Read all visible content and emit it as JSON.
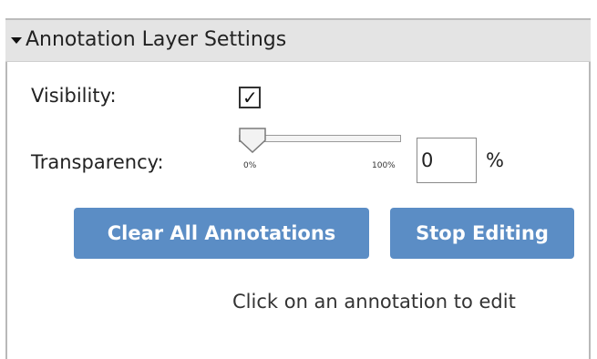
{
  "panel": {
    "title": "Annotation Layer Settings",
    "collapse_icon": "caret-down-icon"
  },
  "visibility": {
    "label": "Visibility:",
    "checked": true,
    "check_glyph": "✓"
  },
  "transparency": {
    "label": "Transparency:",
    "slider_min_label": "0%",
    "slider_max_label": "100%",
    "value": "0",
    "unit": "%",
    "level": 0
  },
  "buttons": {
    "clear_all": "Clear All Annotations",
    "stop_editing": "Stop Editing"
  },
  "hint": "Click on an annotation to edit",
  "colors": {
    "button_bg": "#5b8dc5",
    "header_bg": "#e4e4e4"
  }
}
